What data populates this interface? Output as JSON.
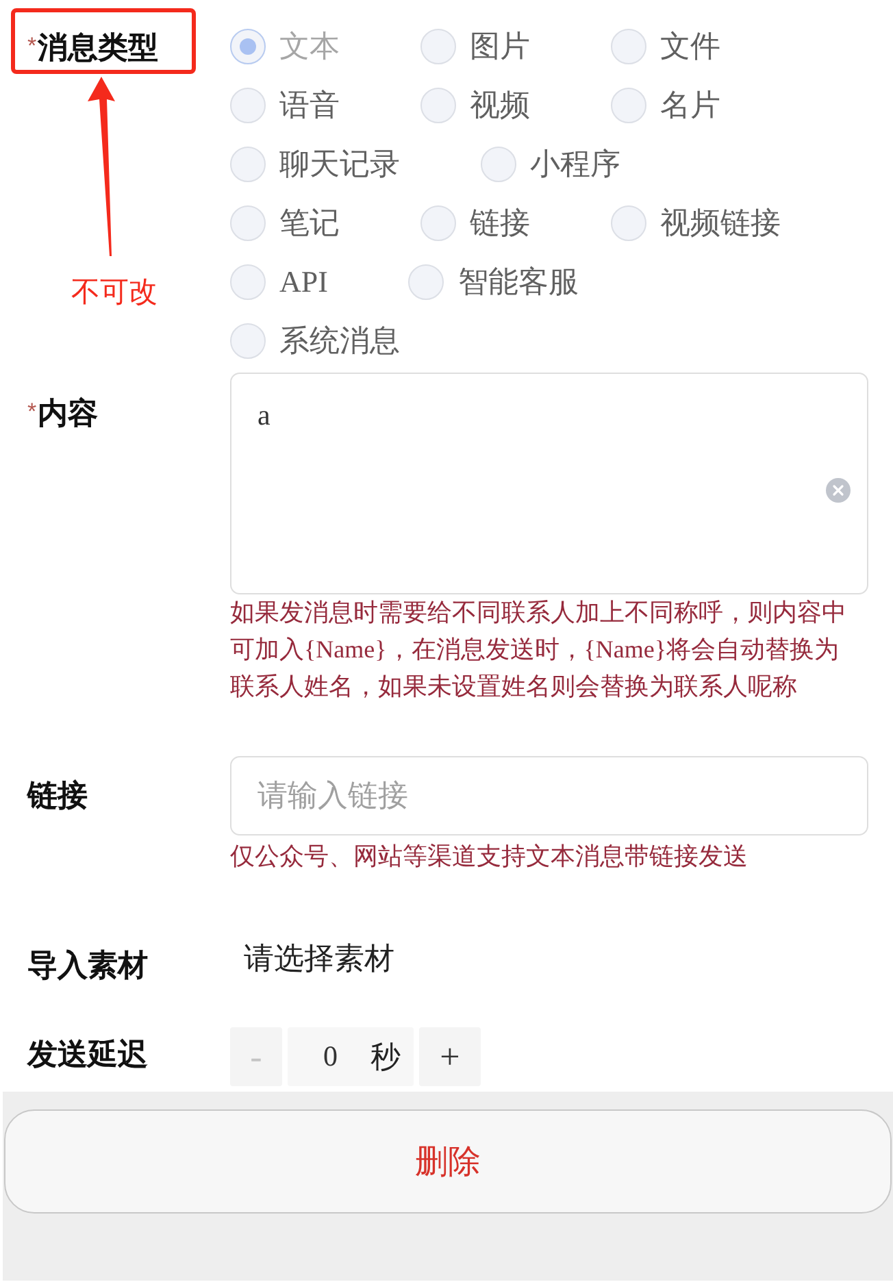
{
  "annotation": {
    "note": "不可改"
  },
  "form": {
    "message_type": {
      "mark": "*",
      "label": "消息类型",
      "disabled": true,
      "options": [
        {
          "label": "文本",
          "selected": true
        },
        {
          "label": "图片",
          "selected": false
        },
        {
          "label": "文件",
          "selected": false
        },
        {
          "label": "语音",
          "selected": false
        },
        {
          "label": "视频",
          "selected": false
        },
        {
          "label": "名片",
          "selected": false
        },
        {
          "label": "聊天记录",
          "selected": false
        },
        {
          "label": "小程序",
          "selected": false
        },
        {
          "label": "笔记",
          "selected": false
        },
        {
          "label": "链接",
          "selected": false
        },
        {
          "label": "视频链接",
          "selected": false
        },
        {
          "label": "API",
          "selected": false
        },
        {
          "label": "智能客服",
          "selected": false
        },
        {
          "label": "系统消息",
          "selected": false
        }
      ]
    },
    "content": {
      "mark": "*",
      "label": "内容",
      "value": "a",
      "hint": "如果发消息时需要给不同联系人加上不同称呼，则内容中可加入{Name}，在消息发送时，{Name}将会自动替换为联系人姓名，如果未设置姓名则会替换为联系人呢称"
    },
    "link": {
      "label": "链接",
      "placeholder": "请输入链接",
      "hint": "仅公众号、网站等渠道支持文本消息带链接发送"
    },
    "material": {
      "label": "导入素材",
      "value": "请选择素材"
    },
    "delay": {
      "label": "发送延迟",
      "decrement": {
        "text": "-",
        "disabled": true
      },
      "value": "0",
      "unit": "秒",
      "increment": {
        "text": "+",
        "disabled": false
      }
    }
  },
  "footer": {
    "delete_button": "删除"
  }
}
